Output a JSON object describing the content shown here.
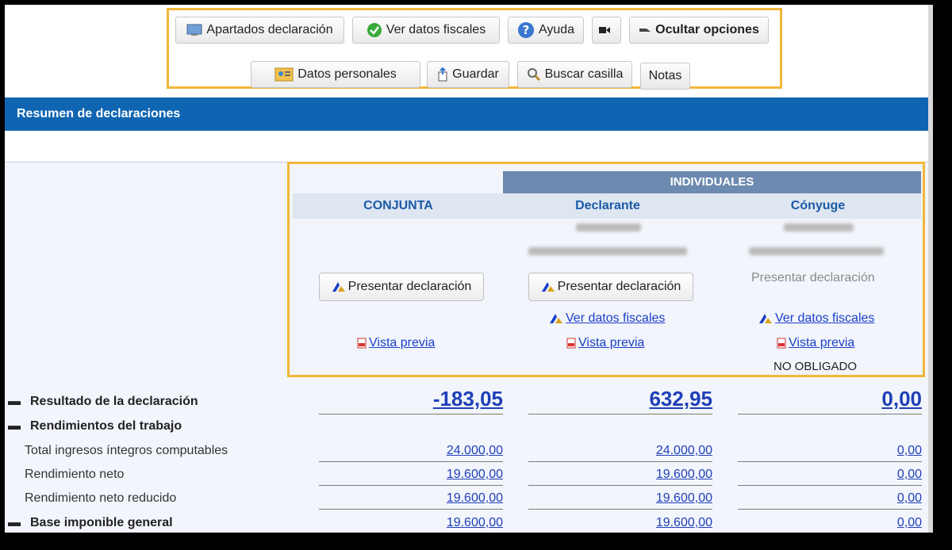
{
  "toolbar": {
    "apartados": "Apartados declaración",
    "ver_datos": "Ver datos fiscales",
    "ayuda": "Ayuda",
    "ocultar": "Ocultar opciones",
    "datos_personales": "Datos personales",
    "guardar": "Guardar",
    "buscar": "Buscar casilla",
    "notas": "Notas"
  },
  "header": {
    "title": "Resumen de declaraciones"
  },
  "columns": {
    "individuales": "INDIVIDUALES",
    "conjunta": "CONJUNTA",
    "declarante": "Declarante",
    "conyuge": "Cónyuge"
  },
  "actions": {
    "presentar": "Presentar declaración",
    "ver_datos_fiscales": "Ver datos fiscales",
    "vista_previa": "Vista previa",
    "no_obligado": "NO OBLIGADO"
  },
  "rows": [
    {
      "label": "Resultado de la declaración",
      "main": true,
      "values": [
        "-183,05",
        "632,95",
        "0,00"
      ]
    },
    {
      "label": "Rendimientos del trabajo",
      "main": true,
      "values": []
    },
    {
      "label": "Total ingresos íntegros computables",
      "main": false,
      "values": [
        "24.000,00",
        "24.000,00",
        "0,00"
      ]
    },
    {
      "label": "Rendimiento neto",
      "main": false,
      "values": [
        "19.600,00",
        "19.600,00",
        "0,00"
      ]
    },
    {
      "label": "Rendimiento neto reducido",
      "main": false,
      "values": [
        "19.600,00",
        "19.600,00",
        "0,00"
      ]
    },
    {
      "label": "Base imponible general",
      "main": true,
      "values": [
        "19.600,00",
        "19.600,00",
        "0,00"
      ]
    }
  ],
  "colors": {
    "accent": "#0f65b1",
    "highlight": "#f0b73a",
    "link": "#1a3fc7"
  }
}
